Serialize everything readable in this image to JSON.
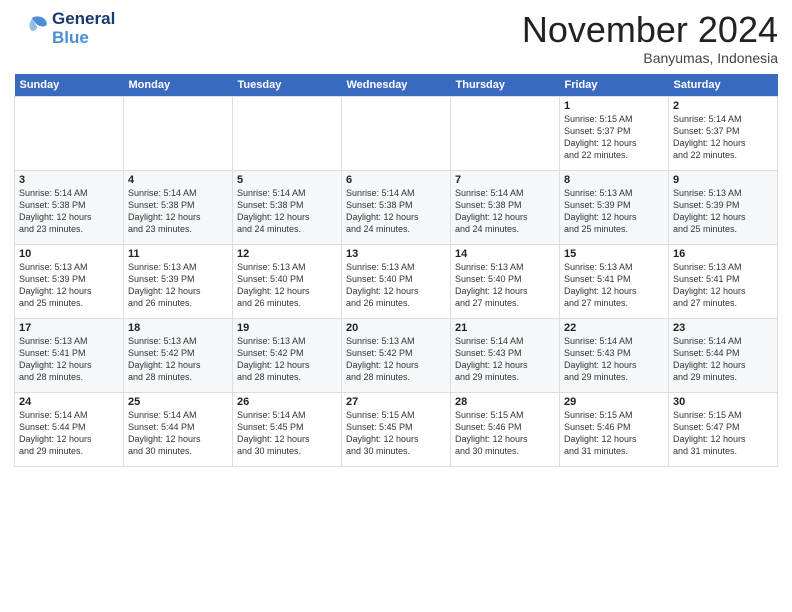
{
  "header": {
    "logo_general": "General",
    "logo_blue": "Blue",
    "month_title": "November 2024",
    "location": "Banyumas, Indonesia"
  },
  "calendar": {
    "days_of_week": [
      "Sunday",
      "Monday",
      "Tuesday",
      "Wednesday",
      "Thursday",
      "Friday",
      "Saturday"
    ],
    "weeks": [
      [
        {
          "day": "",
          "info": ""
        },
        {
          "day": "",
          "info": ""
        },
        {
          "day": "",
          "info": ""
        },
        {
          "day": "",
          "info": ""
        },
        {
          "day": "",
          "info": ""
        },
        {
          "day": "1",
          "info": "Sunrise: 5:15 AM\nSunset: 5:37 PM\nDaylight: 12 hours\nand 22 minutes."
        },
        {
          "day": "2",
          "info": "Sunrise: 5:14 AM\nSunset: 5:37 PM\nDaylight: 12 hours\nand 22 minutes."
        }
      ],
      [
        {
          "day": "3",
          "info": "Sunrise: 5:14 AM\nSunset: 5:38 PM\nDaylight: 12 hours\nand 23 minutes."
        },
        {
          "day": "4",
          "info": "Sunrise: 5:14 AM\nSunset: 5:38 PM\nDaylight: 12 hours\nand 23 minutes."
        },
        {
          "day": "5",
          "info": "Sunrise: 5:14 AM\nSunset: 5:38 PM\nDaylight: 12 hours\nand 24 minutes."
        },
        {
          "day": "6",
          "info": "Sunrise: 5:14 AM\nSunset: 5:38 PM\nDaylight: 12 hours\nand 24 minutes."
        },
        {
          "day": "7",
          "info": "Sunrise: 5:14 AM\nSunset: 5:38 PM\nDaylight: 12 hours\nand 24 minutes."
        },
        {
          "day": "8",
          "info": "Sunrise: 5:13 AM\nSunset: 5:39 PM\nDaylight: 12 hours\nand 25 minutes."
        },
        {
          "day": "9",
          "info": "Sunrise: 5:13 AM\nSunset: 5:39 PM\nDaylight: 12 hours\nand 25 minutes."
        }
      ],
      [
        {
          "day": "10",
          "info": "Sunrise: 5:13 AM\nSunset: 5:39 PM\nDaylight: 12 hours\nand 25 minutes."
        },
        {
          "day": "11",
          "info": "Sunrise: 5:13 AM\nSunset: 5:39 PM\nDaylight: 12 hours\nand 26 minutes."
        },
        {
          "day": "12",
          "info": "Sunrise: 5:13 AM\nSunset: 5:40 PM\nDaylight: 12 hours\nand 26 minutes."
        },
        {
          "day": "13",
          "info": "Sunrise: 5:13 AM\nSunset: 5:40 PM\nDaylight: 12 hours\nand 26 minutes."
        },
        {
          "day": "14",
          "info": "Sunrise: 5:13 AM\nSunset: 5:40 PM\nDaylight: 12 hours\nand 27 minutes."
        },
        {
          "day": "15",
          "info": "Sunrise: 5:13 AM\nSunset: 5:41 PM\nDaylight: 12 hours\nand 27 minutes."
        },
        {
          "day": "16",
          "info": "Sunrise: 5:13 AM\nSunset: 5:41 PM\nDaylight: 12 hours\nand 27 minutes."
        }
      ],
      [
        {
          "day": "17",
          "info": "Sunrise: 5:13 AM\nSunset: 5:41 PM\nDaylight: 12 hours\nand 28 minutes."
        },
        {
          "day": "18",
          "info": "Sunrise: 5:13 AM\nSunset: 5:42 PM\nDaylight: 12 hours\nand 28 minutes."
        },
        {
          "day": "19",
          "info": "Sunrise: 5:13 AM\nSunset: 5:42 PM\nDaylight: 12 hours\nand 28 minutes."
        },
        {
          "day": "20",
          "info": "Sunrise: 5:13 AM\nSunset: 5:42 PM\nDaylight: 12 hours\nand 28 minutes."
        },
        {
          "day": "21",
          "info": "Sunrise: 5:14 AM\nSunset: 5:43 PM\nDaylight: 12 hours\nand 29 minutes."
        },
        {
          "day": "22",
          "info": "Sunrise: 5:14 AM\nSunset: 5:43 PM\nDaylight: 12 hours\nand 29 minutes."
        },
        {
          "day": "23",
          "info": "Sunrise: 5:14 AM\nSunset: 5:44 PM\nDaylight: 12 hours\nand 29 minutes."
        }
      ],
      [
        {
          "day": "24",
          "info": "Sunrise: 5:14 AM\nSunset: 5:44 PM\nDaylight: 12 hours\nand 29 minutes."
        },
        {
          "day": "25",
          "info": "Sunrise: 5:14 AM\nSunset: 5:44 PM\nDaylight: 12 hours\nand 30 minutes."
        },
        {
          "day": "26",
          "info": "Sunrise: 5:14 AM\nSunset: 5:45 PM\nDaylight: 12 hours\nand 30 minutes."
        },
        {
          "day": "27",
          "info": "Sunrise: 5:15 AM\nSunset: 5:45 PM\nDaylight: 12 hours\nand 30 minutes."
        },
        {
          "day": "28",
          "info": "Sunrise: 5:15 AM\nSunset: 5:46 PM\nDaylight: 12 hours\nand 30 minutes."
        },
        {
          "day": "29",
          "info": "Sunrise: 5:15 AM\nSunset: 5:46 PM\nDaylight: 12 hours\nand 31 minutes."
        },
        {
          "day": "30",
          "info": "Sunrise: 5:15 AM\nSunset: 5:47 PM\nDaylight: 12 hours\nand 31 minutes."
        }
      ]
    ]
  }
}
